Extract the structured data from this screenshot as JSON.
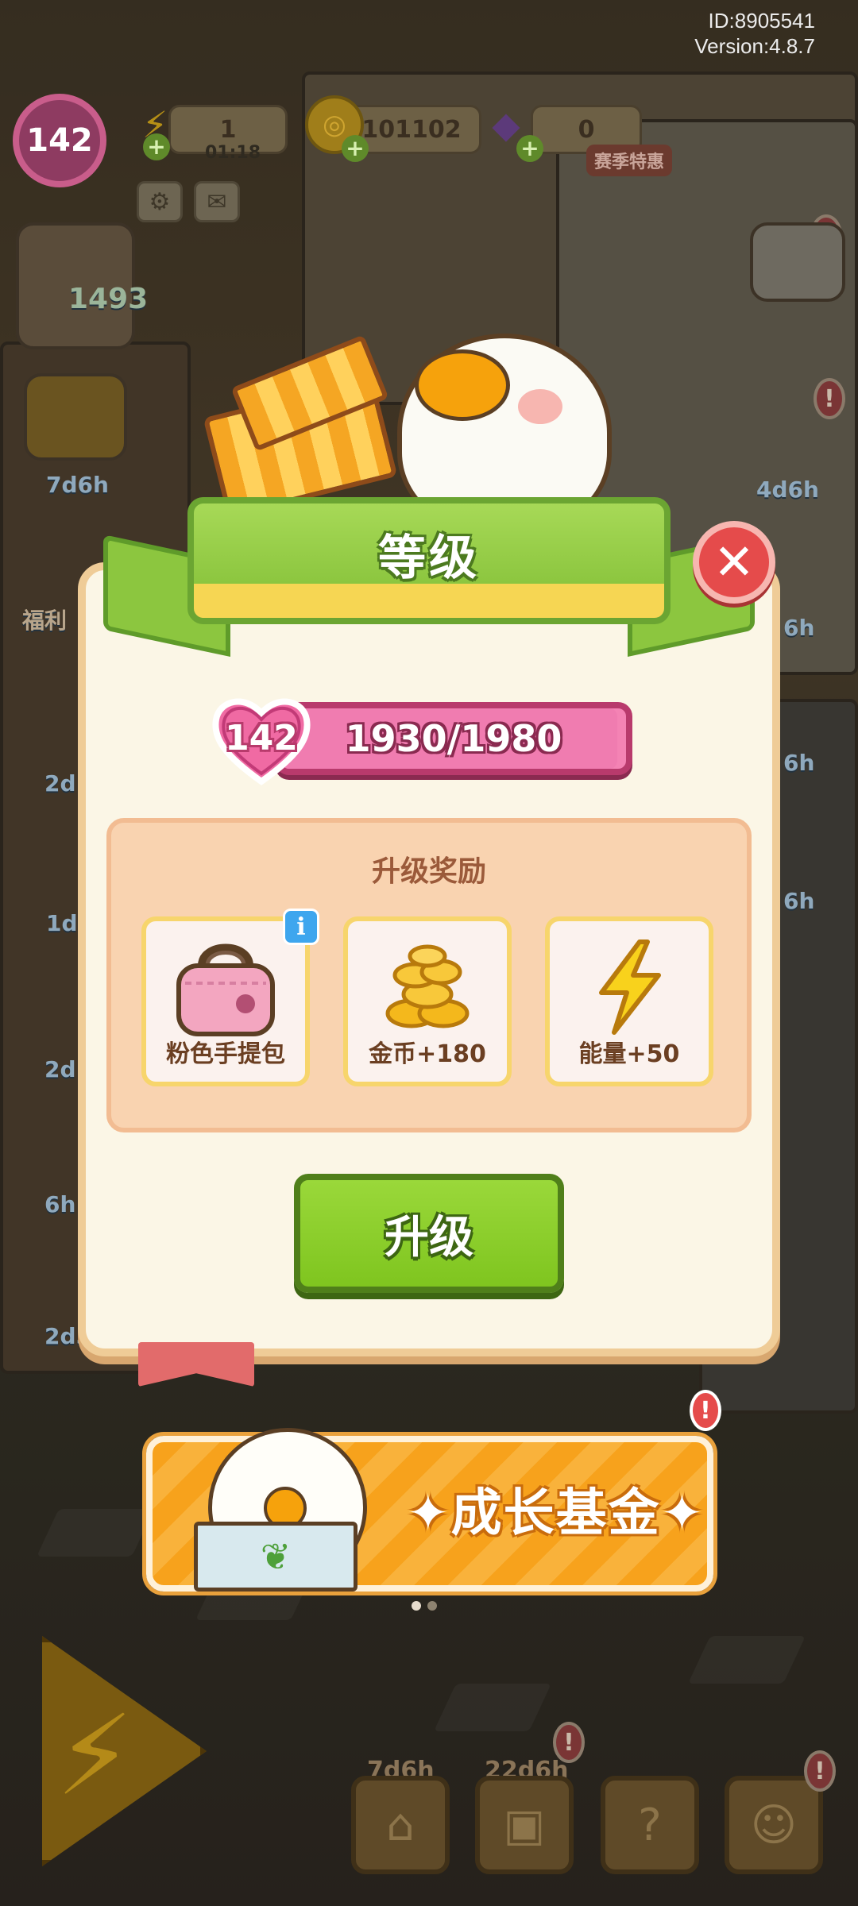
{
  "hud": {
    "account_id": "ID:8905541",
    "version": "Version:4.8.7",
    "player_level": "142",
    "energy": {
      "value": "1",
      "timer": "01:18"
    },
    "coins": "101102",
    "gems": "0",
    "season_tag": "赛季特惠",
    "side_counter": "1493",
    "timers_left": [
      "7d6h",
      "2d",
      "1d",
      "2d",
      "6h",
      "2d5"
    ],
    "timers_right": [
      "4d6h",
      "6h",
      "6h",
      "6h"
    ],
    "side_label": "福利"
  },
  "dialog": {
    "title": "等级",
    "level": "142",
    "progress_text": "1930/1980",
    "progress": {
      "current": 1930,
      "max": 1980
    },
    "rewards_title": "升级奖励",
    "rewards": [
      {
        "label": "粉色手提包",
        "icon": "pink-handbag-icon",
        "has_info": true
      },
      {
        "label": "金币+180",
        "icon": "coins-icon",
        "has_info": false
      },
      {
        "label": "能量+50",
        "icon": "energy-bolt-icon",
        "has_info": false
      }
    ],
    "upgrade_label": "升级"
  },
  "banner": {
    "title": "✦成长基金✦"
  },
  "bottom": {
    "timers": [
      "7d6h",
      "22d6h"
    ]
  },
  "colors": {
    "ribbon_green": "#8cc63f",
    "level_pink": "#f483b4",
    "button_green": "#7fc51f",
    "close_red": "#e54b4b",
    "banner_orange": "#f7a21c"
  }
}
